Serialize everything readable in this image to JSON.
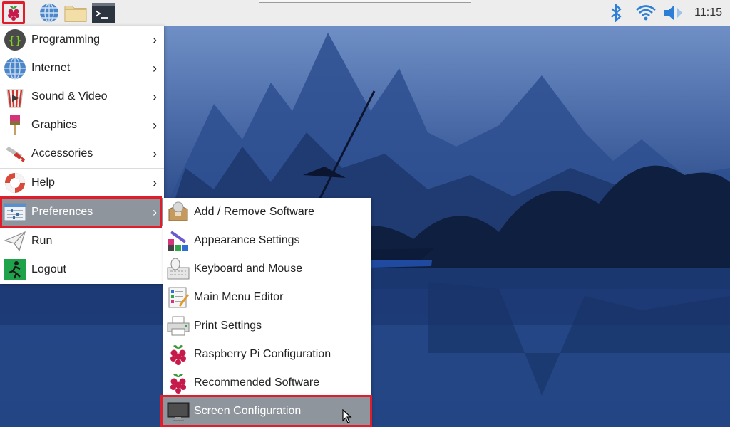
{
  "taskbar": {
    "launchers": [
      {
        "name": "raspberry-menu-icon"
      },
      {
        "name": "web-browser-icon"
      },
      {
        "name": "file-manager-icon"
      },
      {
        "name": "terminal-icon"
      }
    ],
    "tray": {
      "bluetooth": "bluetooth-icon",
      "wifi": "wifi-icon",
      "volume": "volume-icon",
      "clock": "11:15"
    }
  },
  "main_menu": {
    "items": [
      {
        "label": "Programming",
        "icon": "programming-icon",
        "has_submenu": true
      },
      {
        "label": "Internet",
        "icon": "internet-globe-icon",
        "has_submenu": true
      },
      {
        "label": "Sound & Video",
        "icon": "sound-video-icon",
        "has_submenu": true
      },
      {
        "label": "Graphics",
        "icon": "graphics-brush-icon",
        "has_submenu": true
      },
      {
        "label": "Accessories",
        "icon": "accessories-knife-icon",
        "has_submenu": true
      },
      {
        "label": "Help",
        "icon": "help-lifebuoy-icon",
        "has_submenu": true
      },
      {
        "label": "Preferences",
        "icon": "preferences-icon",
        "has_submenu": true,
        "selected": true
      },
      {
        "label": "Run",
        "icon": "run-paperplane-icon",
        "has_submenu": false
      },
      {
        "label": "Logout",
        "icon": "logout-exit-icon",
        "has_submenu": false
      }
    ],
    "submenu_arrow": "›"
  },
  "preferences_menu": {
    "items": [
      {
        "label": "Add / Remove Software",
        "icon": "package-icon"
      },
      {
        "label": "Appearance Settings",
        "icon": "appearance-palette-icon"
      },
      {
        "label": "Keyboard and Mouse",
        "icon": "keyboard-mouse-icon"
      },
      {
        "label": "Main Menu Editor",
        "icon": "menu-editor-icon"
      },
      {
        "label": "Print Settings",
        "icon": "printer-icon"
      },
      {
        "label": "Raspberry Pi Configuration",
        "icon": "raspberry-icon"
      },
      {
        "label": "Recommended Software",
        "icon": "raspberry-icon"
      },
      {
        "label": "Screen Configuration",
        "icon": "monitor-icon",
        "selected": true
      }
    ]
  },
  "colors": {
    "highlight_border": "#e01e2b",
    "selected_bg": "#8e959c",
    "menu_bg": "#ffffff",
    "taskbar_bg": "#ededed"
  }
}
